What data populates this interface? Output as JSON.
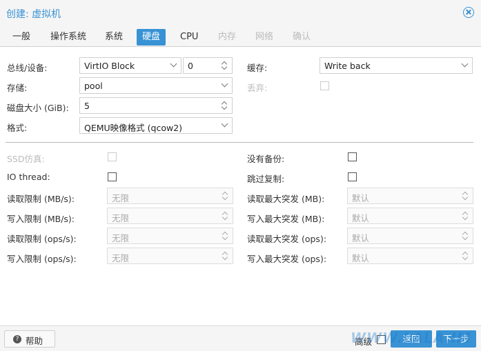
{
  "window": {
    "title": "创建: 虚拟机"
  },
  "tabs": [
    {
      "label": "一般",
      "state": "normal"
    },
    {
      "label": "操作系统",
      "state": "normal"
    },
    {
      "label": "系统",
      "state": "normal"
    },
    {
      "label": "硬盘",
      "state": "active"
    },
    {
      "label": "CPU",
      "state": "normal"
    },
    {
      "label": "内存",
      "state": "disabled"
    },
    {
      "label": "网络",
      "state": "disabled"
    },
    {
      "label": "确认",
      "state": "disabled"
    }
  ],
  "form": {
    "bus_label": "总线/设备:",
    "bus_value": "VirtIO Block",
    "device_value": "0",
    "storage_label": "存储:",
    "storage_value": "pool",
    "disk_size_label": "磁盘大小 (GiB):",
    "disk_size_value": "5",
    "format_label": "格式:",
    "format_value": "QEMU映像格式 (qcow2)",
    "cache_label": "缓存:",
    "cache_value": "Write back",
    "discard_label": "丢弃:",
    "discard_checked": false
  },
  "advanced": {
    "ssd_label": "SSD仿真:",
    "ssd_checked": false,
    "no_backup_label": "没有备份:",
    "no_backup_checked": false,
    "io_thread_label": "IO thread:",
    "io_thread_checked": false,
    "skip_replication_label": "跳过复制:",
    "skip_replication_checked": false,
    "read_limit_mbs_label": "读取限制 (MB/s):",
    "read_limit_mbs_value": "无限",
    "write_limit_mbs_label": "写入限制 (MB/s):",
    "write_limit_mbs_value": "无限",
    "read_limit_ops_label": "读取限制 (ops/s):",
    "read_limit_ops_value": "无限",
    "write_limit_ops_label": "写入限制 (ops/s):",
    "write_limit_ops_value": "无限",
    "read_burst_mb_label": "读取最大突发 (MB):",
    "read_burst_mb_value": "默认",
    "write_burst_mb_label": "写入最大突发 (MB):",
    "write_burst_mb_value": "默认",
    "read_burst_ops_label": "读取最大突发 (ops):",
    "read_burst_ops_value": "默认",
    "write_burst_ops_label": "写入最大突发 (ops):",
    "write_burst_ops_value": "默认"
  },
  "footer": {
    "help_label": "帮助",
    "advanced_label": "高级",
    "back_label": "返回",
    "next_label": "下一步",
    "watermark": "WWW.LALA.IM"
  },
  "colors": {
    "accent": "#3892d4",
    "disabled_text": "#bbbbbb"
  },
  "icons": {
    "close": "close-circle-icon",
    "help": "question-circle-icon"
  }
}
